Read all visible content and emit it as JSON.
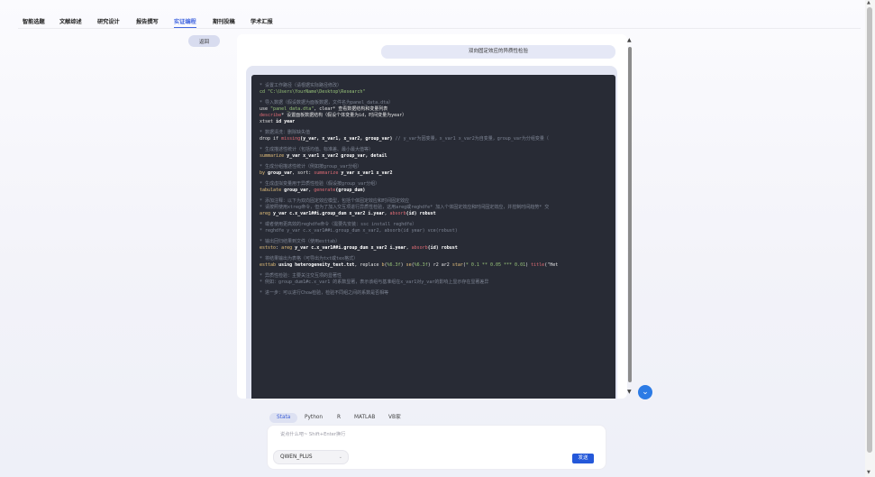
{
  "nav": {
    "tabs": [
      {
        "label": "智能选题"
      },
      {
        "label": "文献综述"
      },
      {
        "label": "研究设计"
      },
      {
        "label": "报告撰写"
      },
      {
        "label": "实证编程",
        "active": true
      },
      {
        "label": "期刊投稿"
      },
      {
        "label": "学术汇报"
      }
    ]
  },
  "back_label": "返回",
  "chat": {
    "user_message": "双向固定效应的异质性检验"
  },
  "code_lines": [
    [
      [
        "c",
        "* 设置工作路径（请根据实际路径修改）"
      ]
    ],
    [
      [
        "s",
        "cd \"C:\\Users\\YourName\\Desktop\\Research\""
      ]
    ],
    [],
    [
      [
        "c",
        "* 导入数据（假设数据为面板数据，文件名为panel_data.dta）"
      ]
    ],
    [
      [
        "t",
        "use "
      ],
      [
        "s",
        "\"panel_data.dta\""
      ],
      [
        "t",
        ", clear* 查看数据结构和变量列表"
      ]
    ],
    [
      [
        "f",
        "describe"
      ],
      [
        "t",
        "* 设置面板数据结构（假设个体变量为id，时间变量为year）"
      ]
    ],
    [
      [
        "t",
        "xtset "
      ],
      [
        "b",
        "id year"
      ]
    ],
    [],
    [
      [
        "c",
        "* 数据清洗：删除缺失值"
      ]
    ],
    [
      [
        "t",
        "drop if "
      ],
      [
        "f",
        "missing"
      ],
      [
        "b",
        "(y_var, x_var1, x_var2, group_var)"
      ],
      [
        "c",
        "  // y_var为因变量，x_var1 x_var2为自变量，group_var为分组变量（"
      ]
    ],
    [],
    [
      [
        "c",
        "* 生成描述性统计（包括均值、标准差、最小最大值等）"
      ]
    ],
    [
      [
        "k",
        "summarize"
      ],
      [
        "b",
        " y_var x_var1 x_var2 group_var, detail"
      ]
    ],
    [],
    [
      [
        "c",
        "* 生成分组描述性统计（例如按group_var分组）"
      ]
    ],
    [
      [
        "k",
        "by"
      ],
      [
        "b",
        " group_var"
      ],
      [
        "t",
        ", sort: "
      ],
      [
        "f",
        "summarize"
      ],
      [
        "b",
        " y_var x_var1 x_var2"
      ]
    ],
    [],
    [
      [
        "c",
        "* 生成虚拟变量用于异质性检验（假设按group_var分组）"
      ]
    ],
    [
      [
        "k",
        "tabulate"
      ],
      [
        "b",
        " group_var"
      ],
      [
        "t",
        ", "
      ],
      [
        "f",
        "generate"
      ],
      [
        "b",
        "(group_dum)"
      ]
    ],
    [],
    [
      [
        "c",
        "* 添加注释：以下为双向固定效应模型，包括个体固定效应和时间固定效应"
      ]
    ],
    [
      [
        "c",
        "* 请按照使用xtreg命令，但为了加入交互项进行异质性检验，这用areg或reghdfe* 加入个体固定效应和时间固定效应，并控制时间趋势* 交"
      ]
    ],
    [
      [
        "k",
        "areg"
      ],
      [
        "b",
        " y_var c.x_var1##i.group_dum x_var2 i.year"
      ],
      [
        "t",
        ", "
      ],
      [
        "f",
        "absorb"
      ],
      [
        "b",
        "(id) robust"
      ]
    ],
    [],
    [
      [
        "c",
        "* 或者使用更高效的reghdfe命令（需要先安装：ssc install reghdfe）"
      ]
    ],
    [
      [
        "c",
        "* reghdfe y_var c.x_var1##i.group_dum x_var2, absorb(id year) vce(robust)"
      ]
    ],
    [],
    [
      [
        "c",
        "* 输出回归结果到文件（使用esttab）"
      ]
    ],
    [
      [
        "k",
        "eststo"
      ],
      [
        "t",
        ": "
      ],
      [
        "k",
        "areg"
      ],
      [
        "b",
        " y_var c.x_var1##i.group_dum x_var2 i.year"
      ],
      [
        "t",
        ", "
      ],
      [
        "f",
        "absorb"
      ],
      [
        "b",
        "(id) robust"
      ]
    ],
    [],
    [
      [
        "c",
        "* 将结果输出为表格（可导出为txt或tex格式）"
      ]
    ],
    [
      [
        "k",
        "esttab"
      ],
      [
        "b",
        " using heterogeneity_test.txt"
      ],
      [
        "t",
        ", replace "
      ],
      [
        "k",
        "b"
      ],
      [
        "t",
        "("
      ],
      [
        "s",
        "%6.3f"
      ],
      [
        "t",
        ") "
      ],
      [
        "k",
        "se"
      ],
      [
        "t",
        "("
      ],
      [
        "s",
        "%6.3f"
      ],
      [
        "t",
        ") r2 ar2 "
      ],
      [
        "k",
        "star"
      ],
      [
        "t",
        "("
      ],
      [
        "s",
        "* 0.1 ** 0.05 *** 0.01"
      ],
      [
        "t",
        ") "
      ],
      [
        "f",
        "title"
      ],
      [
        "t",
        "(\"Het"
      ]
    ],
    [],
    [
      [
        "c",
        "* 异质性检验：主要关注交互项的显著性"
      ]
    ],
    [
      [
        "c",
        "* 例如：group_dum1#c.x_var1 的系数显著，表示该组与基准组在x_var1对y_var的影响上显示存在显著差异"
      ]
    ],
    [],
    [
      [
        "c",
        "* 进一步：可以进行Chow检验，检验不同组之间的系数是否相等"
      ]
    ]
  ],
  "languages": [
    {
      "label": "Stata",
      "active": true
    },
    {
      "label": "Python"
    },
    {
      "label": "R"
    },
    {
      "label": "MATLAB"
    },
    {
      "label": "VB家"
    }
  ],
  "input": {
    "placeholder": "说点什么吧~ Shift+Enter换行",
    "model": "QWEN_PLUS",
    "send_label": "发送"
  },
  "colors": {
    "accent": "#4468e0",
    "send": "#2458d9",
    "code_bg": "#282b35"
  }
}
